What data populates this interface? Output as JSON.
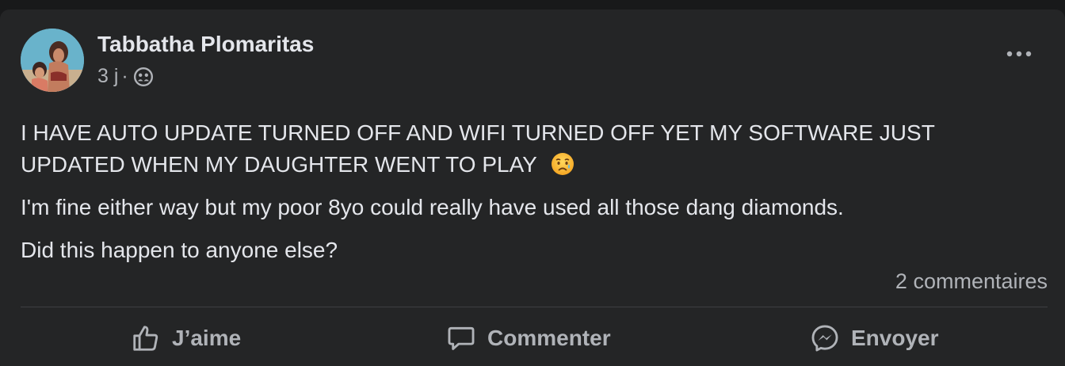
{
  "post": {
    "author": "Tabbatha Plomaritas",
    "time": "3 j",
    "separator": "·",
    "audience_icon": "friends-icon",
    "paragraphs": [
      "I HAVE AUTO UPDATE TURNED OFF AND WIFI TURNED OFF YET MY SOFTWARE JUST UPDATED WHEN MY DAUGHTER WENT TO PLAY",
      "I'm fine either way but my poor 8yo could really have used all those dang diamonds.",
      "Did this happen to anyone else?"
    ],
    "emoji": "sad-tear-emoji",
    "comments_count": "2 commentaires"
  },
  "actions": {
    "like_label": "J’aime",
    "comment_label": "Commenter",
    "send_label": "Envoyer"
  },
  "colors": {
    "background": "#18191a",
    "card": "#242526",
    "primary_text": "#e4e6eb",
    "secondary_text": "#b0b3b8",
    "divider": "#3e4042"
  }
}
